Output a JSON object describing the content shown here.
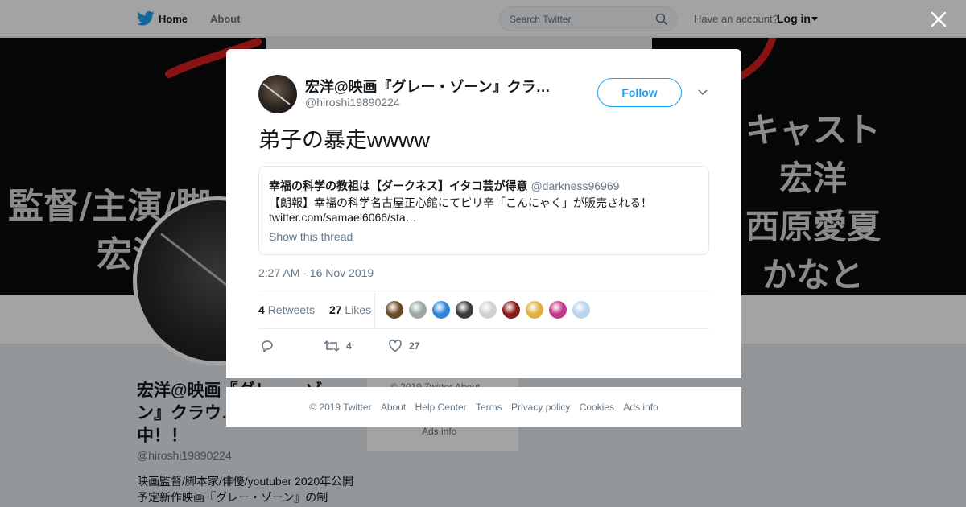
{
  "nav": {
    "home_label": "Home",
    "about_label": "About",
    "search_placeholder": "Search Twitter",
    "account_question": "Have an account?",
    "login_label": "Log in"
  },
  "banner": {
    "left_lines": [
      "監督/主演/脚",
      "宏洋"
    ],
    "right_lines": [
      "キャスト",
      "宏洋",
      "西原愛夏",
      "かなと"
    ]
  },
  "profile": {
    "name": "宏洋@映画『グレー・ゾーン』クラウドファンディング実施中！！",
    "name_visible": "宏洋@映画『グレー・ゾーン』クラウ…ング実施中！！",
    "handle": "@hiroshi19890224",
    "bio": "映画監督/脚本家/俳優/youtuber 2020年公開予定新作映画『グレー・ゾーン』の制"
  },
  "side_footer": {
    "line1": "© 2019 Twitter   About",
    "line2": "Ads info"
  },
  "tweet": {
    "author_name": "宏洋@映画『グレー・ゾーン』クラ…",
    "author_handle": "@hiroshi19890224",
    "follow_label": "Follow",
    "text": "弟子の暴走wwww",
    "quote": {
      "author_name": "幸福の科学の教祖は【ダークネス】イタコ芸が得意",
      "author_handle": "@darkness96969",
      "text_line1": "【朗報】幸福の科学名古屋正心館にてピリ辛「こんにゃく」が販売される！",
      "text_line2": "twitter.com/samael6066/sta…",
      "thread_label": "Show this thread"
    },
    "timestamp": "2:27 AM - 16 Nov 2019",
    "retweets_count": "4",
    "retweets_label": "Retweets",
    "likes_count": "27",
    "likes_label": "Likes",
    "liker_colors": [
      "#6b4a2a",
      "#9aa7a0",
      "#2f86d8",
      "#3a3a3a",
      "#d0d0d0",
      "#8b1a1a",
      "#e0b040",
      "#c03a8a",
      "#b9d3ea"
    ],
    "action_retweet_count": "4",
    "action_like_count": "27"
  },
  "footer": {
    "links": [
      "© 2019 Twitter",
      "About",
      "Help Center",
      "Terms",
      "Privacy policy",
      "Cookies",
      "Ads info"
    ]
  },
  "colors": {
    "accent": "#1da1f2",
    "banner_red": "#d61f1f"
  }
}
